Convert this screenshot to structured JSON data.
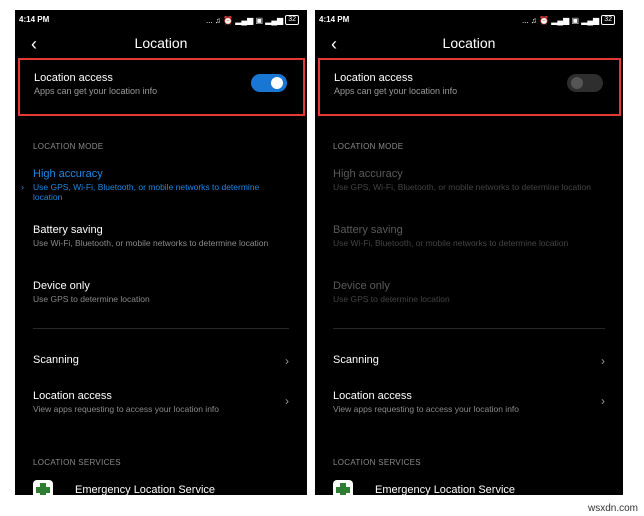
{
  "status_bar": {
    "time": "4:14 PM",
    "icons": "... ♫ ⏰ ▂▄▆ ▣ ▂▄▆",
    "battery": "32"
  },
  "screen": {
    "title": "Location",
    "back_icon": "‹",
    "location_access": {
      "title": "Location access",
      "subtitle": "Apps can get your location info"
    },
    "location_mode_label": "LOCATION MODE",
    "modes": [
      {
        "title": "High accuracy",
        "subtitle": "Use GPS, Wi-Fi, Bluetooth, or mobile networks to determine location"
      },
      {
        "title": "Battery saving",
        "subtitle": "Use Wi-Fi, Bluetooth, or mobile networks to determine location"
      },
      {
        "title": "Device only",
        "subtitle": "Use GPS to determine location"
      }
    ],
    "scanning": "Scanning",
    "location_access_apps": {
      "title": "Location access",
      "subtitle": "View apps requesting to access your location info"
    },
    "location_services_label": "LOCATION SERVICES",
    "emergency_service": "Emergency Location Service",
    "chevron": "›"
  },
  "left_phone": {
    "toggle_state": "on"
  },
  "right_phone": {
    "toggle_state": "off"
  },
  "colors": {
    "accent": "#1976d2",
    "highlight_box": "#e53935",
    "background": "#000000"
  },
  "watermark": "wsxdn.com"
}
